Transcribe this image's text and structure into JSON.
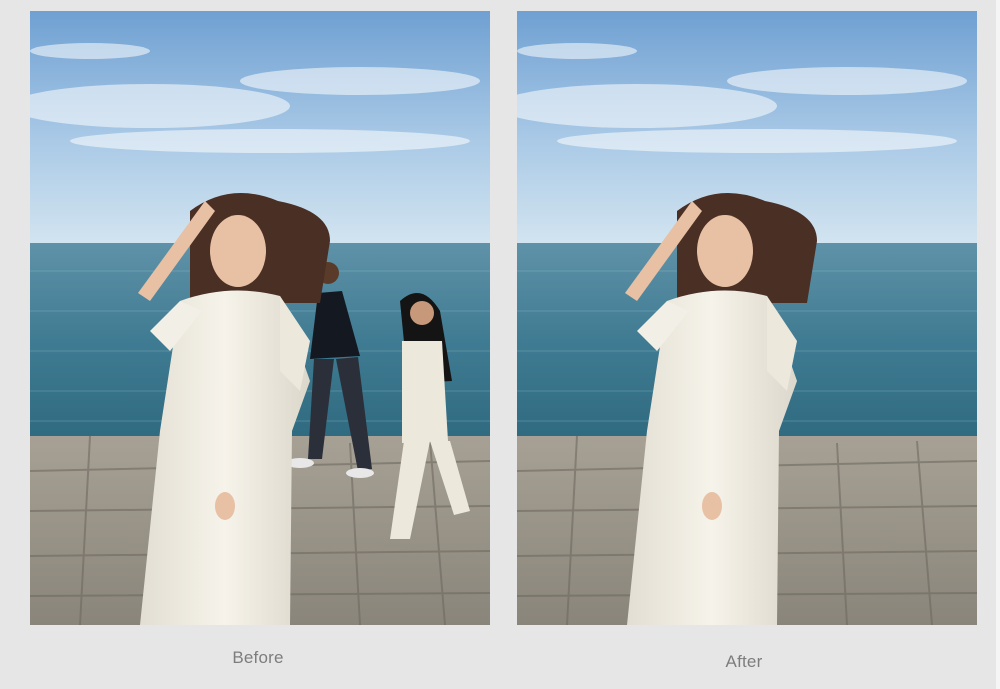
{
  "comparison": {
    "before_label": "Before",
    "after_label": "After"
  },
  "colors": {
    "sky_top": "#6f9fd0",
    "sky_bottom": "#c9dff0",
    "sea": "#3f7c93",
    "stone": "#9c968a",
    "dress": "#f2efe6"
  }
}
